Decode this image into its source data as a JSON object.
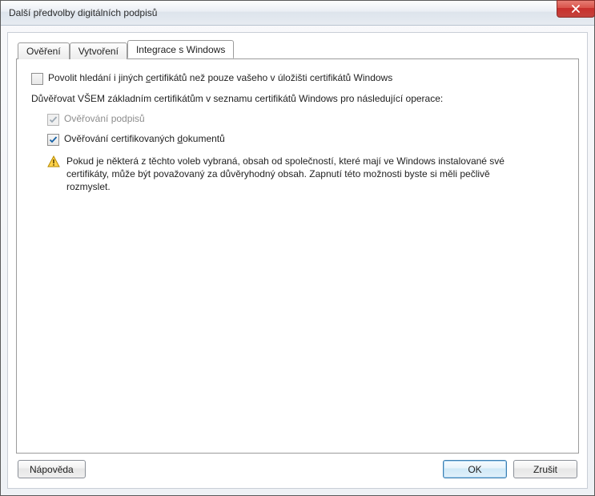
{
  "window": {
    "title": "Další předvolby digitálních podpisů"
  },
  "tabs": [
    {
      "label": "Ověření"
    },
    {
      "label": "Vytvoření"
    },
    {
      "label": "Integrace s Windows"
    }
  ],
  "content": {
    "allow_search": {
      "checked": false,
      "label_pre": "Povolit hledání i jiných ",
      "label_accel": "c",
      "label_post": "ertifikátů než pouze vašeho v úložišti certifikátů Windows"
    },
    "trust_intro": "Důvěřovat VŠEM základním certifikátům v seznamu certifikátů Windows pro následující operace:",
    "verify_sigs": {
      "checked": true,
      "disabled": true,
      "label": "Ověřování podpisů"
    },
    "verify_docs": {
      "checked": true,
      "disabled": false,
      "label_pre": "Ověřování certifikovaných ",
      "label_accel": "d",
      "label_post": "okumentů"
    },
    "warning": "Pokud je některá z těchto voleb vybraná, obsah od společností, které mají ve Windows instalované své certifikáty, může být považovaný za důvěryhodný obsah. Zapnutí této možnosti byste si měli pečlivě rozmyslet."
  },
  "buttons": {
    "help": "Nápověda",
    "ok": "OK",
    "cancel": "Zrušit"
  }
}
